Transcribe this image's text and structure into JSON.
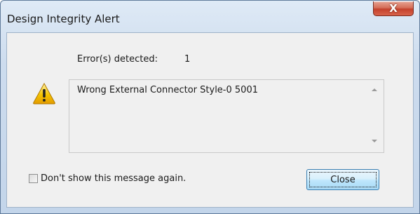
{
  "window": {
    "title": "Design Integrity Alert",
    "close_glyph": "X"
  },
  "summary": {
    "label": "Error(s) detected:",
    "count": "1"
  },
  "message": {
    "text": "Wrong External Connector Style-0 5001"
  },
  "icons": {
    "alert": "warning-icon",
    "scroll_up": "scroll-up-arrow-icon",
    "scroll_down": "scroll-down-arrow-icon"
  },
  "checkbox": {
    "label": "Don't show this message again.",
    "checked": false
  },
  "buttons": {
    "close_label": "Close"
  },
  "colors": {
    "close_x_red": "#c4412c",
    "button_blue": "#3c7fb1",
    "warning_yellow": "#f5c400"
  }
}
